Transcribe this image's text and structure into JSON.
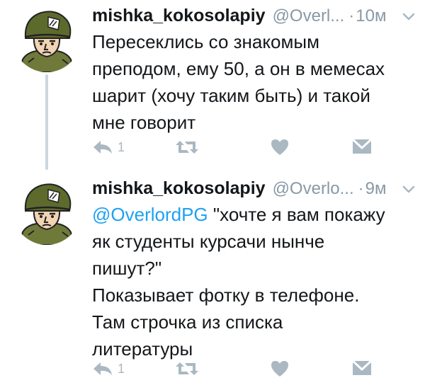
{
  "tweets": [
    {
      "author_name": "mishka_kokosolapiy",
      "handle": "@Overl...",
      "separator": "·",
      "time": "10м",
      "text_lines": [
        "Пересеклись со знакомым",
        "преподом, ему 50, а он в мемесах",
        "шарит (хочу таким быть) и такой",
        "мне говорит"
      ],
      "reply_count": "1"
    },
    {
      "author_name": "mishka_kokosolapiy",
      "handle": "@Overlo...",
      "separator": "·",
      "time": "9м",
      "mention": "@OverlordPG",
      "text_line1_rest": " \"хочте я вам покажу",
      "text_lines": [
        "як студенты курсачи нынче",
        "пишут?\"",
        "Показывает фотку в телефоне.",
        "Там строчка из списка",
        "литературы"
      ],
      "reply_count": "1"
    }
  ],
  "icons": {
    "reply": "reply-icon",
    "retweet": "retweet-icon",
    "like": "heart-icon",
    "dm": "envelope-icon",
    "menu": "chevron-down-icon"
  },
  "colors": {
    "text": "#14171a",
    "muted": "#8899a6",
    "action": "#aab8c2",
    "link": "#1da1f2",
    "thread_line": "#ccd6dd"
  }
}
